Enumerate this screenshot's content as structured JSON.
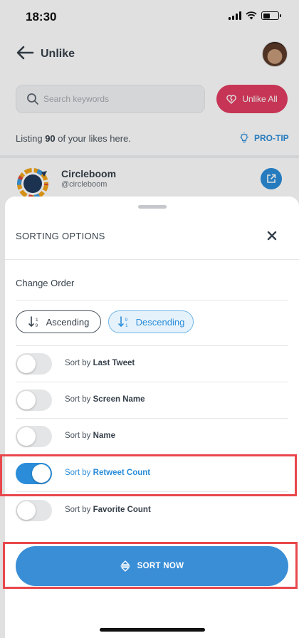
{
  "status_bar": {
    "time": "18:30"
  },
  "header": {
    "title": "Unlike"
  },
  "search": {
    "placeholder": "Search keywords"
  },
  "unlike_all": {
    "label": "Unlike All"
  },
  "listing": {
    "prefix": "Listing",
    "count": "90",
    "suffix": "of your likes here."
  },
  "pro_tip": {
    "label": "PRO-TIP"
  },
  "user": {
    "name": "Circleboom",
    "handle": "@circleboom"
  },
  "sheet": {
    "title": "SORTING OPTIONS",
    "change_order": "Change Order",
    "ascending": "Ascending",
    "descending": "Descending",
    "sort_prefix": "Sort by",
    "options": [
      {
        "label": "Last Tweet",
        "on": false
      },
      {
        "label": "Screen Name",
        "on": false
      },
      {
        "label": "Name",
        "on": false
      },
      {
        "label": "Retweet Count",
        "on": true
      },
      {
        "label": "Favorite Count",
        "on": false
      }
    ],
    "sort_now": "SORT NOW"
  },
  "colors": {
    "accent": "#2b8dd9",
    "danger": "#e23d61",
    "highlight": "#e8474c"
  }
}
